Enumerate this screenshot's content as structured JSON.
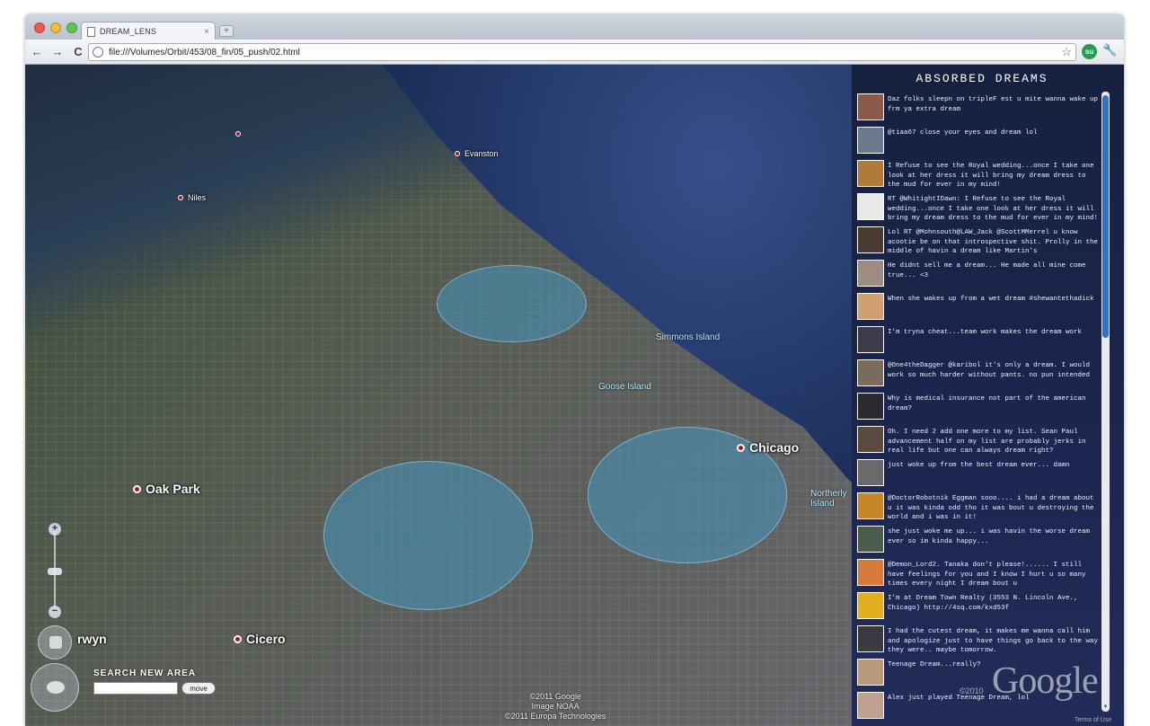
{
  "browser": {
    "tab_title": "DREAM_LENS",
    "tab_close": "×",
    "new_tab": "+",
    "url": "file:///Volumes/Orbit/453/08_fin/05_push/02.html",
    "back": "←",
    "forward": "→",
    "reload": "C",
    "star": "☆",
    "su": "su",
    "wrench": "🔧"
  },
  "map": {
    "places": [
      {
        "name": "Evanston"
      },
      {
        "name": "Niles"
      },
      {
        "name": "Chicago"
      },
      {
        "name": "Oak Park"
      },
      {
        "name": "Cicero"
      },
      {
        "name": "rwyn"
      }
    ],
    "water_labels": [
      "Simmons Island",
      "Goose Island",
      "Northerly Island"
    ],
    "zoom_in": "+",
    "zoom_out": "−",
    "search": {
      "title": "SEARCH NEW AREA",
      "input_value": "",
      "button": "move"
    },
    "copyright": [
      "©2011 Google",
      "Image NOAA",
      "©2011 Europa Technologies"
    ]
  },
  "sidebar": {
    "title": "ABSORBED DREAMS",
    "google_logo": "Google",
    "google_year": "©2010",
    "terms": "Terms of Use",
    "tweets": [
      {
        "text": "Daz folks sleepn on tripleF est u mite wanna wake up frm ya extra dream",
        "avatar_color": "#8b5a4a"
      },
      {
        "text": "@tiaa67 close your eyes and dream lol",
        "avatar_color": "#6a7a8c"
      },
      {
        "text": "I Refuse to see the Royal wedding...once I take one look at her dress it will bring my dream dress to the mud for ever in my mind!",
        "avatar_color": "#b07a3a"
      },
      {
        "text": "RT @WhitightIDawn: I Refuse to see the Royal wedding...once I take one look at her dress it will bring my dream dress to the mud for ever in my mind!",
        "avatar_color": "#e8e8e8"
      },
      {
        "text": "Lol RT @Mohnsouth@LAW_Jack @ScottMMerrel u know acootie be on that introspective shit. Prolly in the middle of havin a dream like Martin's",
        "avatar_color": "#4a3a32"
      },
      {
        "text": "He didnt sell me a dream... He made all mine come true... <3",
        "avatar_color": "#9c8c82"
      },
      {
        "text": "When she wakes up from a wet dream #shewantethadick",
        "avatar_color": "#d1a070"
      },
      {
        "text": "I'm tryna cheat...team work makes the dream work",
        "avatar_color": "#3c3c4c"
      },
      {
        "text": "@One4theDagger @karibol it's only a dream. I would work so much harder without pants. no pun intended",
        "avatar_color": "#7c6a5a"
      },
      {
        "text": "Why is medical insurance not part of the american dream?",
        "avatar_color": "#2a2a30"
      },
      {
        "text": "Oh. I need 2 add one more to my list. Sean Paul advancement half on my list are probably jerks in real life but one can always dream right?",
        "avatar_color": "#5a4a42"
      },
      {
        "text": "just woke up from the best dream ever... damn",
        "avatar_color": "#6a6a6a"
      },
      {
        "text": "@DoctorRobotnik Eggman sooo.... i had a dream about u it was kinda odd tho it was bout u destroying the world and i was in it!",
        "avatar_color": "#c8862a"
      },
      {
        "text": "she just woke me up... i was havin the worse dream ever so im kinda happy...",
        "avatar_color": "#4c5c4c"
      },
      {
        "text": "@Demon_Lord2. Tanaka don't please!...... I still have feelings for you and I know I hurt u so many times every night I dream bout u",
        "avatar_color": "#d87a3a"
      },
      {
        "text": "I'm at Dream Town Realty (3553 N. Lincoln Ave., Chicago) http://4sq.com/kxd53f",
        "avatar_color": "#e0b020"
      },
      {
        "text": "I had the cutest dream, it makes me wanna call him and apologize just to have things go back to the way they were.. maybe tomorrow.",
        "avatar_color": "#3a3a42"
      },
      {
        "text": "Teenage Dream...really?",
        "avatar_color": "#b89a7a"
      },
      {
        "text": "Alex just played Teenage Dream, lol",
        "avatar_color": "#c0a090"
      }
    ]
  }
}
